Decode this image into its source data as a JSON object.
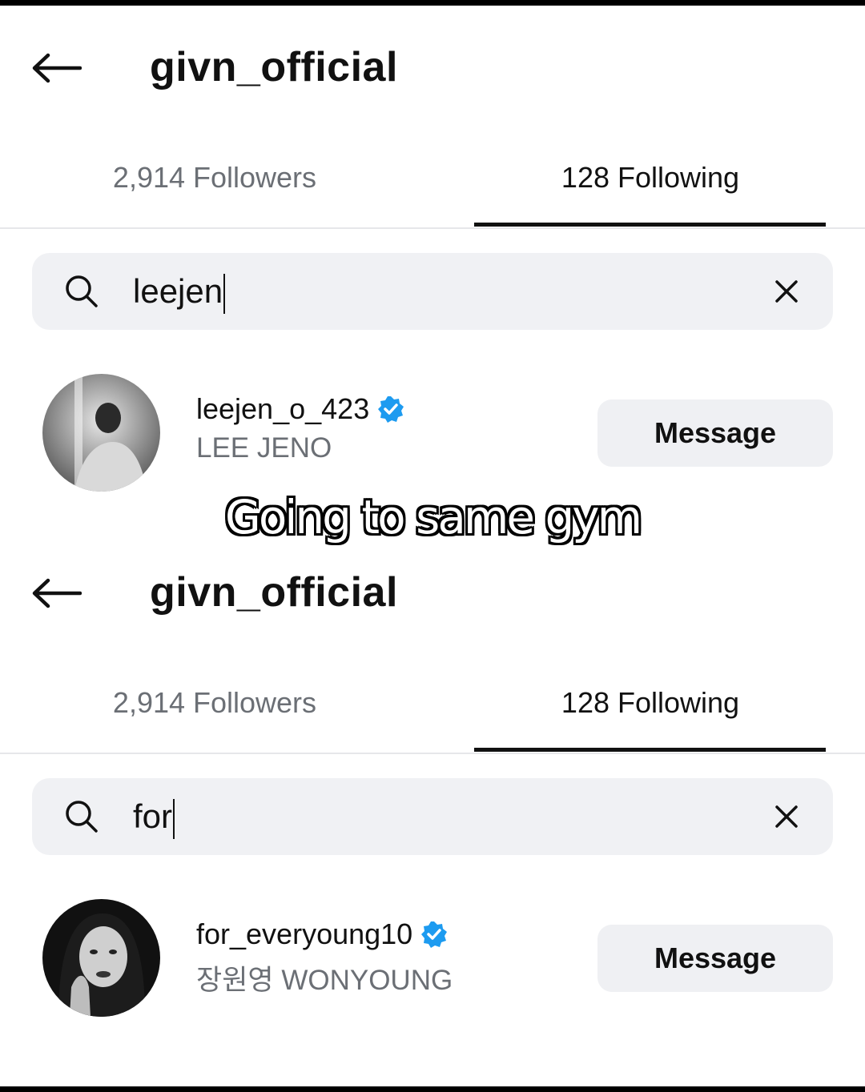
{
  "caption": "Going to same gym",
  "panels": [
    {
      "header": {
        "title": "givn_official"
      },
      "tabs": {
        "followers": "2,914 Followers",
        "following": "128 Following"
      },
      "search": {
        "value": "leejen"
      },
      "result": {
        "username": "leejen_o_423",
        "full_name": "LEE JENO",
        "verified": true,
        "button": "Message"
      }
    },
    {
      "header": {
        "title": "givn_official"
      },
      "tabs": {
        "followers": "2,914 Followers",
        "following": "128 Following"
      },
      "search": {
        "value": "for"
      },
      "result": {
        "username": "for_everyoung10",
        "full_name": "장원영 WONYOUNG",
        "verified": true,
        "button": "Message"
      }
    }
  ],
  "colors": {
    "verified": "#1d9bf0",
    "muted_text": "#6b6f75",
    "button_bg": "#eff0f3",
    "search_bg": "#f0f1f4"
  }
}
